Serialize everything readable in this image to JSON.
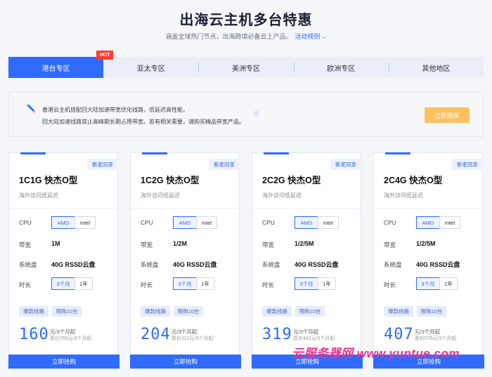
{
  "header": {
    "title": "出海云主机多台特惠",
    "subtitle": "涵盖全球热门节点，出海跨境必备云上产品。",
    "rules_link": "活动规则→"
  },
  "tabs": [
    {
      "label": "港台专区",
      "active": true,
      "badge": "HOT"
    },
    {
      "label": "亚太专区",
      "active": false
    },
    {
      "label": "美洲专区",
      "active": false
    },
    {
      "label": "欧洲专区",
      "active": false
    },
    {
      "label": "其他地区",
      "active": false
    }
  ],
  "banner": {
    "icon": "rocket-icon",
    "line1": "香港云主机搭配回大陆加速带宽优化线路，低延迟高性能。",
    "line2": "回大陆加速线路禁止高峰期长期占用带宽，若有相关需要，请购买精品带宽产品。",
    "button": "立即购买"
  },
  "labels": {
    "cpu": "CPU",
    "bandwidth": "带宽",
    "disk": "系统盘",
    "duration": "时长"
  },
  "options": {
    "cpu": [
      "AMD",
      "Intel"
    ],
    "duration": [
      "3个月",
      "1年"
    ]
  },
  "cards": [
    {
      "tag": "新老同享",
      "title": "1C1G 快杰O型",
      "desc": "海外访问低延迟",
      "bandwidth": "1M",
      "disk": "40G RSSD云盘",
      "pills": [
        "爆款线路",
        "限购10台"
      ],
      "price": "160",
      "unit": "元/3个月起",
      "original": "原价255元/3个月起",
      "buy": "立即抢购"
    },
    {
      "tag": "新老同享",
      "title": "1C2G 快杰O型",
      "desc": "海外访问低延迟",
      "bandwidth": "1/2M",
      "disk": "40G RSSD云盘",
      "pills": [
        "爆款线路",
        "限购10台"
      ],
      "price": "204",
      "unit": "元/3个月起",
      "original": "原价312元/3个月起",
      "buy": "立即抢购"
    },
    {
      "tag": "新老同享",
      "title": "2C2G 快杰O型",
      "desc": "海外访问低延迟",
      "bandwidth": "1/2/5M",
      "disk": "40G RSSD云盘",
      "pills": [
        "爆款线路",
        "限购10台"
      ],
      "price": "319",
      "unit": "元/3个月起",
      "original": "原价462元/3个月起",
      "buy": "立即抢购"
    },
    {
      "tag": "新老同享",
      "title": "2C4G 快杰O型",
      "desc": "海外访问低延迟",
      "bandwidth": "1/2/5M",
      "disk": "40G RSSD云盘",
      "pills": [
        "爆款线路",
        "限购10台"
      ],
      "price": "407",
      "unit": "元/3个月起",
      "original": "原价576元/3个月起",
      "buy": "立即抢购"
    }
  ],
  "watermark": "云服务器网 www.yuntue.com",
  "colors": {
    "accent": "#2f6bff",
    "hot": "#ff3d2e",
    "cta": "#ffc05f",
    "watermark": "#e8358e"
  }
}
